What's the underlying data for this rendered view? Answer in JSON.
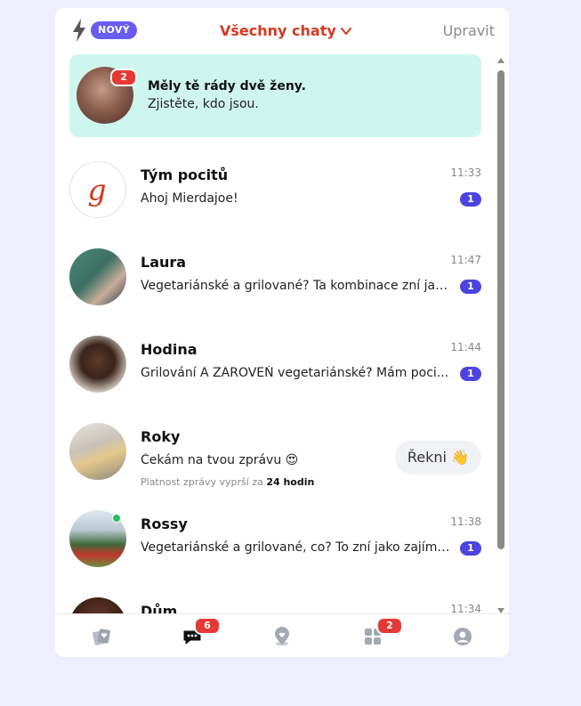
{
  "header": {
    "new_label": "NOVÝ",
    "filter_label": "Všechny chaty",
    "edit_label": "Upravit"
  },
  "promo": {
    "badge": "2",
    "title": "Měly tě rády dvě ženy.",
    "subtitle": "Zjistěte, kdo jsou."
  },
  "chats": [
    {
      "name": "Tým pocitů",
      "message": "Ahoj Mierdajoe!",
      "time": "11:33",
      "unread": "1"
    },
    {
      "name": "Laura",
      "message": "Vegetariánské a grilované? Ta kombinace zní jak...",
      "time": "11:47",
      "unread": "1"
    },
    {
      "name": "Hodina",
      "message": "Grilování A ZÁROVEŇ vegetariánské? Mám poci...",
      "time": "11:44",
      "unread": "1"
    },
    {
      "name": "Roky",
      "message": "Čekám na tvou zprávu 😍",
      "expire_prefix": "Platnost zprávy vyprší za",
      "expire_value": "24 hodin",
      "action_label": "Řekni 👋"
    },
    {
      "name": "Rossy",
      "message": "Vegetariánské a grilované, co? To zní jako zajíma...",
      "time": "11:38",
      "unread": "1",
      "online": true
    },
    {
      "name": "Dům",
      "message": "",
      "time": "11:34"
    }
  ],
  "nav": {
    "items": [
      {
        "icon": "cards-icon"
      },
      {
        "icon": "chat-icon",
        "badge": "6",
        "active": true
      },
      {
        "icon": "map-pin-heart-icon"
      },
      {
        "icon": "grid-icon",
        "badge": "2"
      },
      {
        "icon": "profile-icon"
      }
    ]
  },
  "colors": {
    "accent_red": "#d6371f",
    "badge_purple": "#6b5cf0",
    "unread_blue": "#4b44e0",
    "promo_bg": "#cef6ef",
    "page_bg": "#efeefc"
  }
}
